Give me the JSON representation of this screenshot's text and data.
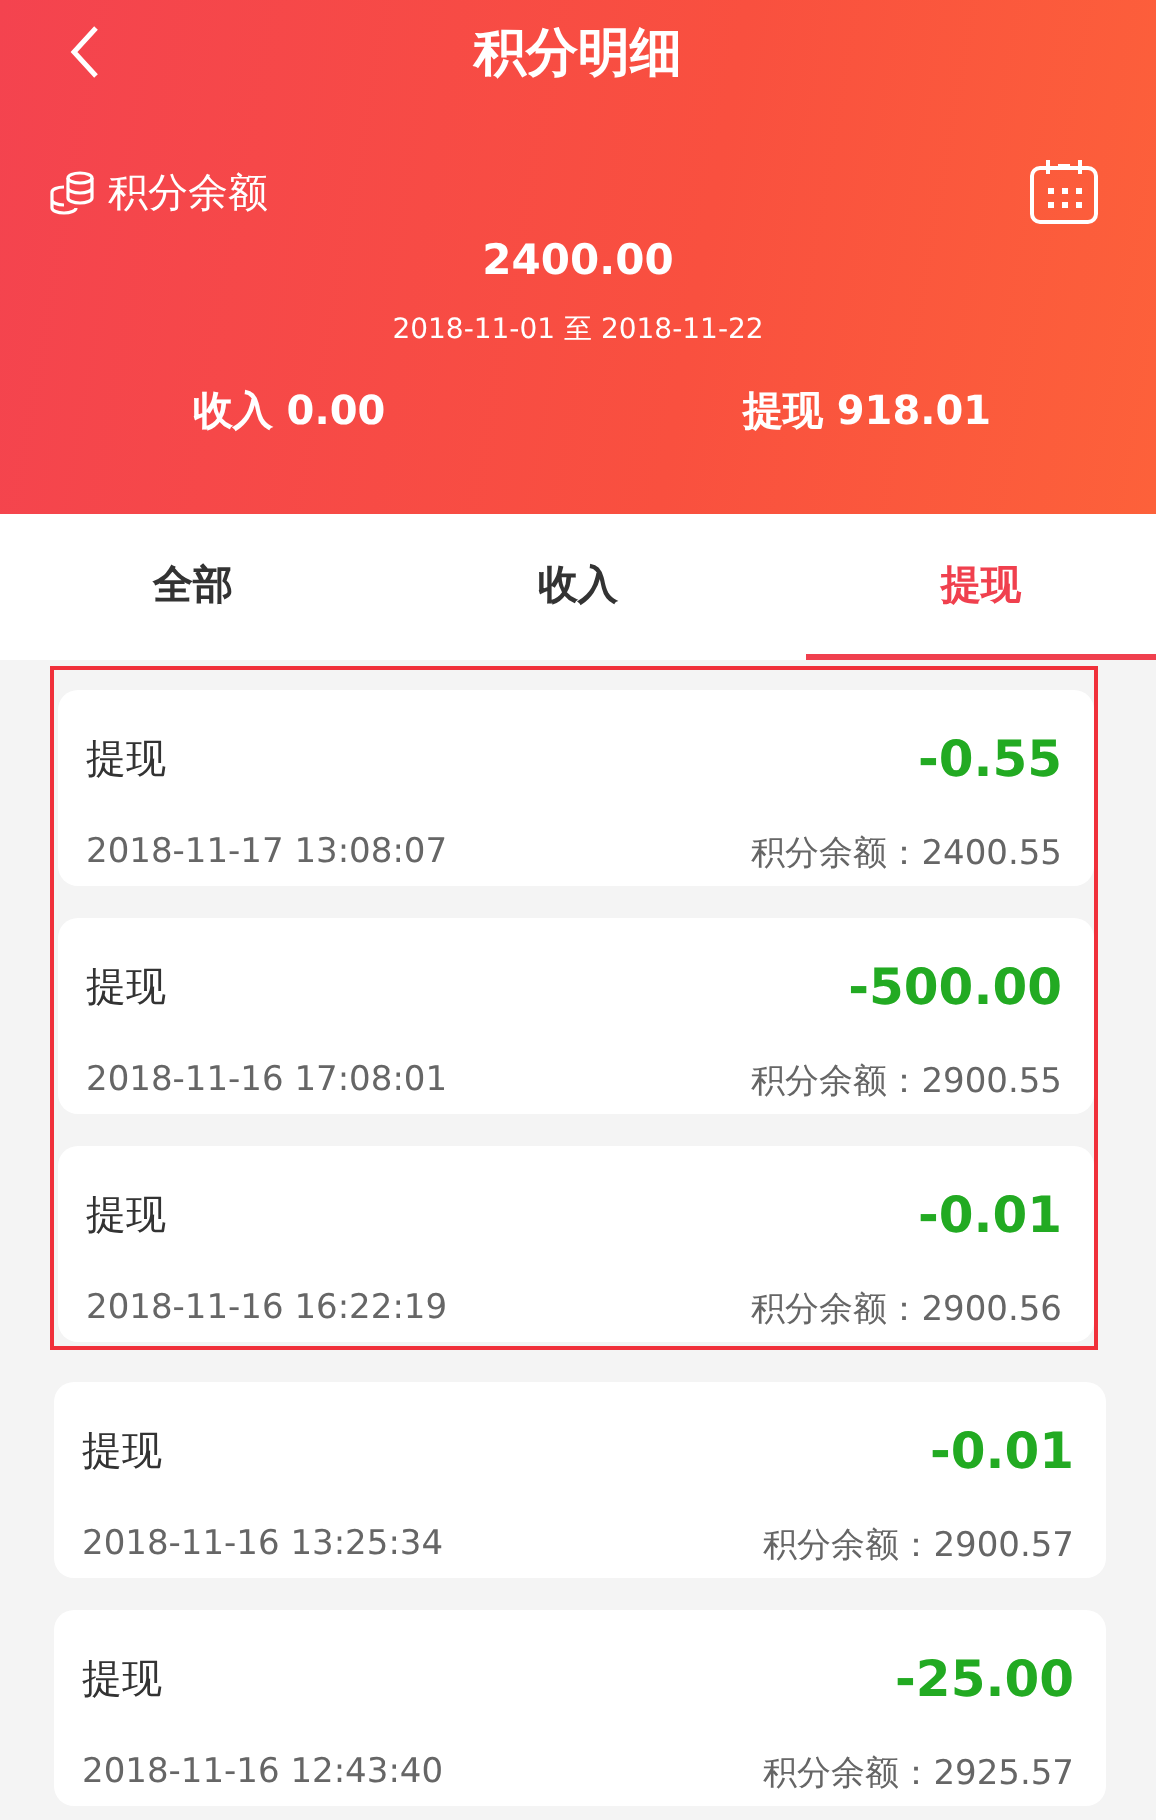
{
  "header": {
    "title": "积分明细",
    "balance_label": "积分余额",
    "balance": "2400.00",
    "date_range": "2018-11-01 至 2018-11-22",
    "income": "收入 0.00",
    "withdrawal": "提现 918.01"
  },
  "tabs": [
    {
      "label": "全部",
      "selected": false
    },
    {
      "label": "收入",
      "selected": false
    },
    {
      "label": "提现",
      "selected": true
    }
  ],
  "records": [
    {
      "type": "提现",
      "amount": "-0.55",
      "time": "2018-11-17 13:08:07",
      "balance": "积分余额：2400.55",
      "highlighted": true
    },
    {
      "type": "提现",
      "amount": "-500.00",
      "time": "2018-11-16 17:08:01",
      "balance": "积分余额：2900.55",
      "highlighted": true
    },
    {
      "type": "提现",
      "amount": "-0.01",
      "time": "2018-11-16 16:22:19",
      "balance": "积分余额：2900.56",
      "highlighted": true
    },
    {
      "type": "提现",
      "amount": "-0.01",
      "time": "2018-11-16 13:25:34",
      "balance": "积分余额：2900.57",
      "highlighted": false
    },
    {
      "type": "提现",
      "amount": "-25.00",
      "time": "2018-11-16 12:43:40",
      "balance": "积分余额：2925.57",
      "highlighted": false
    }
  ]
}
